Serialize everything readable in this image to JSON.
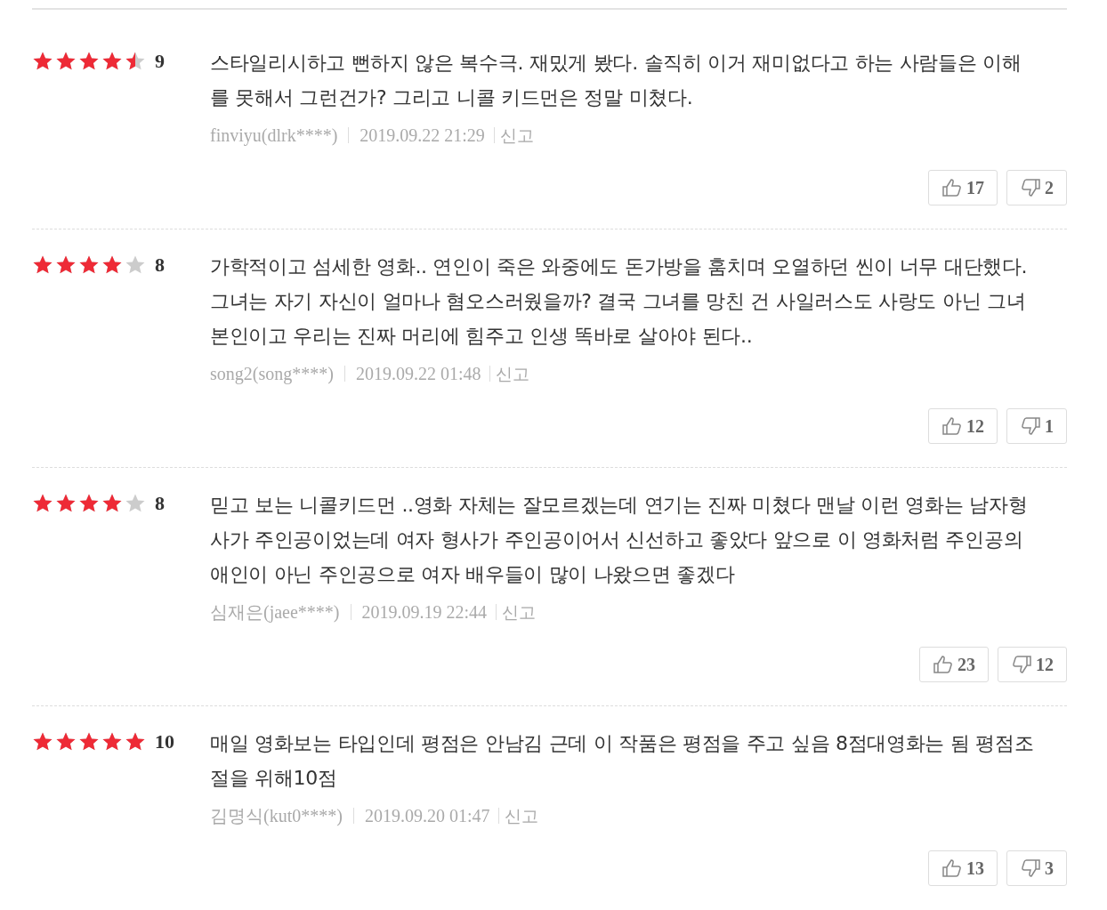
{
  "reviews": [
    {
      "stars": 4.5,
      "score": "9",
      "text": "스타일리시하고 뻔하지 않은 복수극. 재밌게 봤다. 솔직히 이거 재미없다고 하는 사람들은 이해를 못해서 그런건가? 그리고 니콜 키드먼은 정말 미쳤다.",
      "author": "finviyu(dlrk****)",
      "date": "2019.09.22 21:29",
      "report": "신고",
      "likes": "17",
      "dislikes": "2"
    },
    {
      "stars": 4,
      "score": "8",
      "text": "가학적이고 섬세한 영화.. 연인이 죽은 와중에도 돈가방을 훔치며 오열하던 씬이 너무 대단했다. 그녀는 자기 자신이 얼마나 혐오스러웠을까? 결국 그녀를 망친 건 사일러스도 사랑도 아닌 그녀 본인이고 우리는 진짜 머리에 힘주고 인생 똑바로 살아야 된다..",
      "author": "song2(song****)",
      "date": "2019.09.22 01:48",
      "report": "신고",
      "likes": "12",
      "dislikes": "1"
    },
    {
      "stars": 4,
      "score": "8",
      "text": "믿고 보는 니콜키드먼 ..영화 자체는 잘모르겠는데 연기는 진짜 미쳤다 맨날 이런 영화는 남자형사가 주인공이었는데 여자 형사가 주인공이어서 신선하고 좋았다 앞으로 이 영화처럼 주인공의 애인이 아닌 주인공으로 여자 배우들이 많이 나왔으면 좋겠다",
      "author": "심재은(jaee****)",
      "date": "2019.09.19 22:44",
      "report": "신고",
      "likes": "23",
      "dislikes": "12"
    },
    {
      "stars": 5,
      "score": "10",
      "text": "매일 영화보는 타입인데 평점은 안남김 근데 이 작품은 평점을 주고 싶음 8점대영화는 됨 평점조절을 위해10점",
      "author": "김명식(kut0****)",
      "date": "2019.09.20 01:47",
      "report": "신고",
      "likes": "13",
      "dislikes": "3"
    }
  ]
}
